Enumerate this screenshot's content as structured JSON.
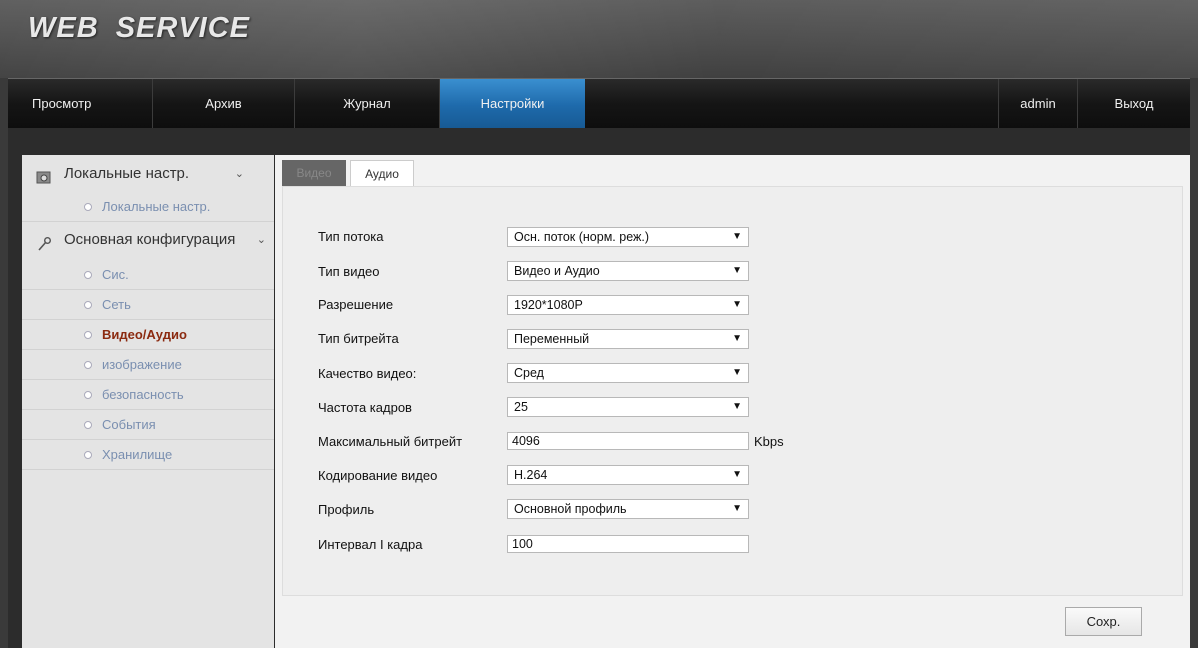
{
  "header": {
    "logo": "WEB SERVICE"
  },
  "nav": {
    "items": [
      {
        "label": "Просмотр"
      },
      {
        "label": "Архив"
      },
      {
        "label": "Журнал"
      },
      {
        "label": "Настройки",
        "active": true
      }
    ],
    "user": "admin",
    "logout": "Выход"
  },
  "sidebar": {
    "group1": {
      "label": "Локальные настр.",
      "icon": "settings-icon"
    },
    "group1_items": [
      {
        "label": "Локальные настр."
      }
    ],
    "group2": {
      "label": "Основная конфигурация",
      "icon": "wrench-icon"
    },
    "group2_items": [
      {
        "label": "Сис."
      },
      {
        "label": "Сеть"
      },
      {
        "label": "Видео/Аудио",
        "active": true
      },
      {
        "label": "изображение"
      },
      {
        "label": "безопасность"
      },
      {
        "label": "События"
      },
      {
        "label": "Хранилище"
      }
    ]
  },
  "tabs": [
    {
      "label": "Видео",
      "selected": true
    },
    {
      "label": "Аудио"
    }
  ],
  "form": {
    "stream_type": {
      "label": "Тип потока",
      "value": "Осн. поток (норм. реж.)"
    },
    "video_type": {
      "label": "Тип видео",
      "value": "Видео и Аудио"
    },
    "resolution": {
      "label": "Разрешение",
      "value": "1920*1080P"
    },
    "bitrate_type": {
      "label": "Тип битрейта",
      "value": "Переменный"
    },
    "video_quality": {
      "label": "Качество видео:",
      "value": "Сред"
    },
    "frame_rate": {
      "label": "Частота кадров",
      "value": "25"
    },
    "max_bitrate": {
      "label": "Максимальный битрейт",
      "value": "4096",
      "unit": "Kbps"
    },
    "video_encoding": {
      "label": "Кодирование видео",
      "value": "H.264"
    },
    "profile": {
      "label": "Профиль",
      "value": "Основной профиль"
    },
    "i_frame_interval": {
      "label": "Интервал I кадра",
      "value": "100"
    }
  },
  "save_button": "Сохр.",
  "colors": {
    "accent": "#1e6aab",
    "active_menu": "#8b2a10",
    "menu_link": "#7a8fb0"
  }
}
